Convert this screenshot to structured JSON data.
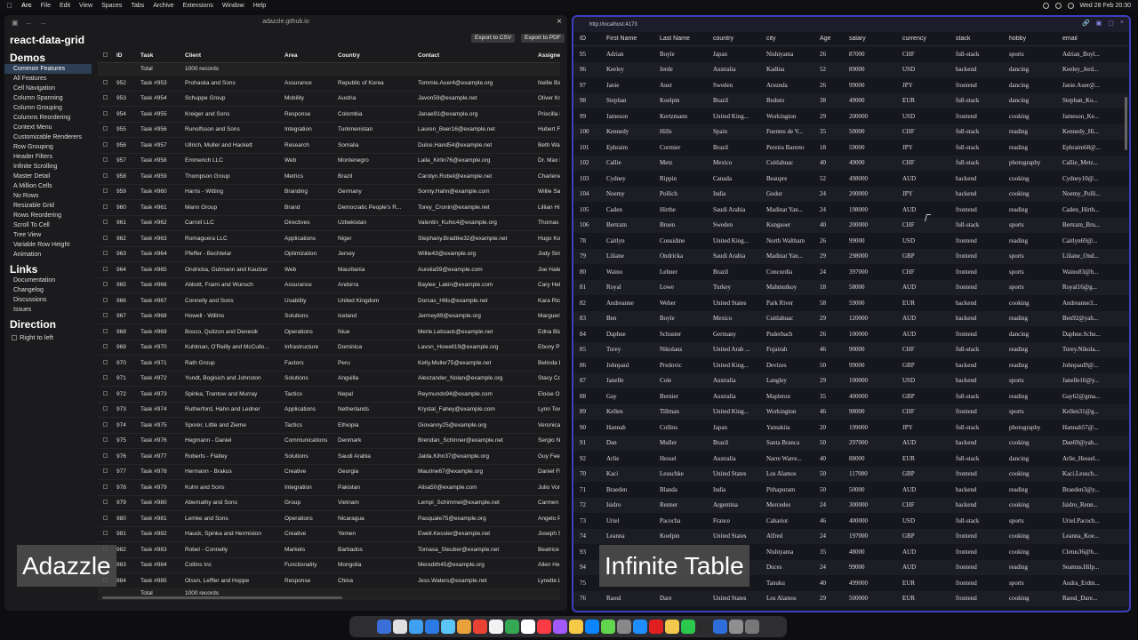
{
  "menubar": {
    "items": [
      "Arc",
      "File",
      "Edit",
      "View",
      "Spaces",
      "Tabs",
      "Archive",
      "Extensions",
      "Window",
      "Help"
    ],
    "clock": "Wed 28 Feb  20:30"
  },
  "left_window": {
    "url": "adazzle.github.io",
    "title": "react-data-grid",
    "sections": {
      "demos": "Demos",
      "links": "Links",
      "direction": "Direction"
    },
    "demos": [
      "Common Features",
      "All Features",
      "Cell Navigation",
      "Column Spanning",
      "Column Grouping",
      "Columns Reordering",
      "Context Menu",
      "Customizable Renderers",
      "Row Grouping",
      "Header Filters",
      "Infinite Scrolling",
      "Master Detail",
      "A Million Cells",
      "No Rows",
      "Resizable Grid",
      "Rows Reordering",
      "Scroll To Cell",
      "Tree View",
      "Variable Row Height",
      "Animation"
    ],
    "links": [
      "Documentation",
      "Changelog",
      "Discussions",
      "Issues"
    ],
    "rtl_label": "Right to left",
    "export_csv": "Export to CSV",
    "export_pdf": "Export to PDF",
    "columns": [
      "ID",
      "Task",
      "Client",
      "Area",
      "Country",
      "Contact",
      "Assignee"
    ],
    "total_label": "Total",
    "total_value": "1000 records",
    "rows": [
      [
        "952",
        "Task #953",
        "Prohaska and Sons",
        "Assurance",
        "Republic of Korea",
        "Tommie.Auer4@example.org",
        "Nellie Bay"
      ],
      [
        "953",
        "Task #954",
        "Schuppe Group",
        "Mobility",
        "Austria",
        "Javon59@example.net",
        "Oliver Kre"
      ],
      [
        "954",
        "Task #955",
        "Kreiger and Sons",
        "Response",
        "Colombia",
        "Janae91@example.org",
        "Priscilla L"
      ],
      [
        "955",
        "Task #956",
        "Runolfsson and Sons",
        "Integration",
        "Turkmenistan",
        "Lauren_Beer16@example.net",
        "Hubert Fe"
      ],
      [
        "956",
        "Task #957",
        "Ullrich, Muller and Hackett",
        "Research",
        "Somalia",
        "Dulce.Hand54@example.net",
        "Beth Walk"
      ],
      [
        "957",
        "Task #958",
        "Emmerich LLC",
        "Web",
        "Montenegro",
        "Laila_Kirlin76@example.org",
        "Dr. Max K"
      ],
      [
        "958",
        "Task #959",
        "Thompson Group",
        "Metrics",
        "Brazil",
        "Carolyn.Robel@example.net",
        "Charlene"
      ],
      [
        "959",
        "Task #960",
        "Harris - Witting",
        "Branding",
        "Germany",
        "Sonny.Hahn@example.com",
        "Willie Saw"
      ],
      [
        "960",
        "Task #961",
        "Mann Group",
        "Brand",
        "Democratic People's R...",
        "Torey_Cronin@example.net",
        "Lillian Hill"
      ],
      [
        "961",
        "Task #962",
        "Carroll LLC",
        "Directives",
        "Uzbekistan",
        "Valentin_Kuhic4@example.org",
        "Thomas E"
      ],
      [
        "962",
        "Task #963",
        "Romaguera LLC",
        "Applications",
        "Niger",
        "Stephany.Bradtke32@example.net",
        "Hugo Koc"
      ],
      [
        "963",
        "Task #964",
        "Pfeffer - Bechtelar",
        "Optimization",
        "Jersey",
        "Willie43@example.org",
        "Jody Sim"
      ],
      [
        "964",
        "Task #965",
        "Ondricka, Gutmann and Kautzer",
        "Web",
        "Mauritania",
        "Aurelia59@example.com",
        "Joe Haley"
      ],
      [
        "965",
        "Task #966",
        "Abbott, Frami and Wunsch",
        "Assurance",
        "Andorra",
        "Baylee_Lakin@example.com",
        "Cary Hett"
      ],
      [
        "966",
        "Task #967",
        "Connelly and Sons",
        "Usability",
        "United Kingdom",
        "Dorcas_Hills@example.net",
        "Kara Rtcl"
      ],
      [
        "967",
        "Task #968",
        "Howell - Willms",
        "Solutions",
        "Iceland",
        "Jermey89@example.org",
        "Marguerit"
      ],
      [
        "968",
        "Task #969",
        "Bosco, Quitzon and Denesik",
        "Operations",
        "Niue",
        "Merle.Lebsack@example.net",
        "Edna Blar"
      ],
      [
        "969",
        "Task #970",
        "Kuhlman, O'Reilly and McCullo...",
        "Infrastructure",
        "Dominica",
        "Lavon_Howell19@example.org",
        "Ebony Pre"
      ],
      [
        "970",
        "Task #971",
        "Rath Group",
        "Factors",
        "Peru",
        "Kelly.Muller75@example.net",
        "Belinda L"
      ],
      [
        "971",
        "Task #972",
        "Yundt, Bogisich and Johnston",
        "Solutions",
        "Anguilla",
        "Alexzander_Nolan@example.org",
        "Stacy Cor"
      ],
      [
        "972",
        "Task #973",
        "Spinka, Trantow and Murray",
        "Tactics",
        "Nepal",
        "Reymundo94@example.com",
        "Eloise Ort"
      ],
      [
        "973",
        "Task #974",
        "Rutherford, Hahn and Ledner",
        "Applications",
        "Netherlands",
        "Krystal_Fahey@example.com",
        "Lynn Tow"
      ],
      [
        "974",
        "Task #975",
        "Sporer, Little and Zieme",
        "Tactics",
        "Ethiopia",
        "Giovanny25@example.org",
        "Veronica I"
      ],
      [
        "975",
        "Task #976",
        "Hegmann - Daniel",
        "Communications",
        "Denmark",
        "Brendan_Schinner@example.net",
        "Sergio Nc"
      ],
      [
        "976",
        "Task #977",
        "Roberts - Flatley",
        "Solutions",
        "Saudi Arabia",
        "Jaida.Kihn37@example.org",
        "Guy Fees"
      ],
      [
        "977",
        "Task #978",
        "Hermann - Brakus",
        "Creative",
        "Georgia",
        "Maurine67@example.org",
        "Daniel Fla"
      ],
      [
        "978",
        "Task #979",
        "Kuhn and Sons",
        "Integration",
        "Pakistan",
        "Alisa50@example.com",
        "Julio Vonl"
      ],
      [
        "979",
        "Task #980",
        "Abernathy and Sons",
        "Group",
        "Vietnam",
        "Lempi_Schimmel@example.net",
        "Carmen H"
      ],
      [
        "980",
        "Task #981",
        "Lemke and Sons",
        "Operations",
        "Nicaragua",
        "Pasquale75@example.org",
        "Angelo Pf"
      ],
      [
        "981",
        "Task #982",
        "Hauck, Spinka and Hermiston",
        "Creative",
        "Yemen",
        "Ewell.Kessler@example.net",
        "Joseph Sl"
      ],
      [
        "982",
        "Task #983",
        "Robel - Connelly",
        "Markets",
        "Barbados",
        "Tomasa_Steuber@example.net",
        "Beatrice F"
      ],
      [
        "983",
        "Task #984",
        "Collins Inc",
        "Functionality",
        "Mongolia",
        "Meredith45@example.org",
        "Allen Herr"
      ],
      [
        "984",
        "Task #985",
        "Olson, Leffler and Hoppe",
        "Response",
        "China",
        "Jess.Waters@example.net",
        "Lynette Le"
      ]
    ]
  },
  "right_window": {
    "url": "http://localhost:4173",
    "columns": [
      "ID",
      "First Name",
      "Last Name",
      "country",
      "city",
      "Age",
      "salary",
      "currency",
      "stack",
      "hobby",
      "email"
    ],
    "rows": [
      [
        "95",
        "Adrian",
        "Boyle",
        "Japan",
        "Nishiyama",
        "26",
        "87000",
        "CHF",
        "full-stack",
        "sports",
        "Adrian_Boyl..."
      ],
      [
        "96",
        "Keeley",
        "Jerde",
        "Australia",
        "Kadina",
        "52",
        "89000",
        "USD",
        "backend",
        "dancing",
        "Keeley_Jerd..."
      ],
      [
        "97",
        "Janie",
        "Auer",
        "Sweden",
        "Arsunda",
        "26",
        "99000",
        "JPY",
        "frontend",
        "dancing",
        "Janie.Auer@..."
      ],
      [
        "98",
        "Stephan",
        "Koelpin",
        "Brazil",
        "Reduto",
        "38",
        "49000",
        "EUR",
        "full-stack",
        "dancing",
        "Stephan_Ko..."
      ],
      [
        "99",
        "Jameson",
        "Kertzmann",
        "United King...",
        "Workington",
        "29",
        "200000",
        "USD",
        "frontend",
        "cooking",
        "Jameson_Ke..."
      ],
      [
        "100",
        "Kennedy",
        "Hills",
        "Spain",
        "Fuentes de V...",
        "35",
        "50000",
        "CHF",
        "full-stack",
        "reading",
        "Kennedy_Hi..."
      ],
      [
        "101",
        "Ephraim",
        "Cormier",
        "Brazil",
        "Pereira Barreto",
        "18",
        "59000",
        "JPY",
        "full-stack",
        "reading",
        "Ephraim68@..."
      ],
      [
        "102",
        "Callie",
        "Metz",
        "Mexico",
        "Cuitlahuac",
        "40",
        "49000",
        "CHF",
        "full-stack",
        "photography",
        "Callie_Metz..."
      ],
      [
        "103",
        "Cydney",
        "Rippin",
        "Canada",
        "Beaupre",
        "52",
        "498000",
        "AUD",
        "backend",
        "cooking",
        "Cydney10@..."
      ],
      [
        "104",
        "Noemy",
        "Pollich",
        "India",
        "Gudur",
        "24",
        "200000",
        "JPY",
        "backend",
        "cooking",
        "Noemy_Polli..."
      ],
      [
        "105",
        "Caden",
        "Hirthe",
        "Saudi Arabia",
        "Madinat Yan...",
        "24",
        "198000",
        "AUD",
        "frontend",
        "reading",
        "Caden_Hirth..."
      ],
      [
        "106",
        "Bertram",
        "Bruen",
        "Sweden",
        "Kungsoer",
        "40",
        "200000",
        "CHF",
        "full-stack",
        "sports",
        "Bertram_Bru..."
      ],
      [
        "78",
        "Caitlyn",
        "Considine",
        "United King...",
        "North Waltham",
        "26",
        "99000",
        "USD",
        "frontend",
        "reading",
        "Caitlyn69@..."
      ],
      [
        "79",
        "Liliane",
        "Ondricka",
        "Saudi Arabia",
        "Madinat Yan...",
        "29",
        "298000",
        "GBP",
        "frontend",
        "sports",
        "Liliane_Ond..."
      ],
      [
        "80",
        "Waino",
        "Lehner",
        "Brazil",
        "Concordia",
        "24",
        "397000",
        "CHF",
        "frontend",
        "sports",
        "Waino83@h..."
      ],
      [
        "81",
        "Royal",
        "Lowe",
        "Turkey",
        "Mahmutkoy",
        "18",
        "58000",
        "AUD",
        "frontend",
        "sports",
        "Royal16@g..."
      ],
      [
        "82",
        "Andreanne",
        "Weber",
        "United States",
        "Park River",
        "58",
        "59000",
        "EUR",
        "backend",
        "cooking",
        "Andreanne3..."
      ],
      [
        "83",
        "Ben",
        "Boyle",
        "Mexico",
        "Cuitlahuac",
        "29",
        "120000",
        "AUD",
        "backend",
        "reading",
        "Ben92@yah..."
      ],
      [
        "84",
        "Daphne",
        "Schuster",
        "Germany",
        "Puderbach",
        "26",
        "100000",
        "AUD",
        "frontend",
        "dancing",
        "Daphne.Schu..."
      ],
      [
        "85",
        "Torey",
        "Nikolaus",
        "United Arab ...",
        "Fujairah",
        "46",
        "90000",
        "CHF",
        "full-stack",
        "reading",
        "Torey.Nikola..."
      ],
      [
        "86",
        "Johnpaul",
        "Predovic",
        "United King...",
        "Devizes",
        "50",
        "99000",
        "GBP",
        "backend",
        "reading",
        "Johnpaul9@..."
      ],
      [
        "87",
        "Janelle",
        "Cole",
        "Australia",
        "Langley",
        "29",
        "100000",
        "USD",
        "backend",
        "sports",
        "Janelle16@y..."
      ],
      [
        "88",
        "Gay",
        "Bernier",
        "Australia",
        "Mapleton",
        "35",
        "400000",
        "GBP",
        "full-stack",
        "reading",
        "Gay62@gma..."
      ],
      [
        "89",
        "Kellen",
        "Tillman",
        "United King...",
        "Workington",
        "46",
        "98000",
        "CHF",
        "frontend",
        "sports",
        "Kellen31@g..."
      ],
      [
        "90",
        "Hannah",
        "Collins",
        "Japan",
        "Yamakita",
        "20",
        "199000",
        "JPY",
        "full-stack",
        "photography",
        "Hannah57@..."
      ],
      [
        "91",
        "Dan",
        "Muller",
        "Brazil",
        "Santa Branca",
        "50",
        "297000",
        "AUD",
        "backend",
        "cooking",
        "Dan69@yah..."
      ],
      [
        "92",
        "Arlie",
        "Hessel",
        "Australia",
        "Narre Warre...",
        "40",
        "88000",
        "EUR",
        "full-stack",
        "dancing",
        "Arlie_Hessel..."
      ],
      [
        "70",
        "Kaci",
        "Leuschke",
        "United States",
        "Los Alamos",
        "50",
        "117000",
        "GBP",
        "frontend",
        "cooking",
        "Kaci.Leusch..."
      ],
      [
        "71",
        "Braeden",
        "Blanda",
        "India",
        "Pithapuram",
        "50",
        "50000",
        "AUD",
        "backend",
        "reading",
        "Braeden3@y..."
      ],
      [
        "72",
        "Isidro",
        "Renner",
        "Argentina",
        "Mercedes",
        "24",
        "300000",
        "CHF",
        "backend",
        "cooking",
        "Isidro_Renn..."
      ],
      [
        "73",
        "Uriel",
        "Pacocha",
        "France",
        "Cabariot",
        "46",
        "400000",
        "USD",
        "full-stack",
        "sports",
        "Uriel.Pacoch..."
      ],
      [
        "74",
        "Leanna",
        "Koelpin",
        "United States",
        "Alfred",
        "24",
        "197000",
        "GBP",
        "frontend",
        "cooking",
        "Leanna_Koe..."
      ],
      [
        "93",
        "",
        "",
        "",
        "Nishiyama",
        "35",
        "48000",
        "AUD",
        "frontend",
        "cooking",
        "Cletus36@h..."
      ],
      [
        "94",
        "",
        "",
        "",
        "Duces",
        "24",
        "99000",
        "AUD",
        "frontend",
        "reading",
        "Seamus.Hilp..."
      ],
      [
        "75",
        "",
        "",
        "",
        "Tanuku",
        "40",
        "499000",
        "EUR",
        "frontend",
        "sports",
        "Audra_Erdm..."
      ],
      [
        "76",
        "Raoul",
        "Dare",
        "United States",
        "Los Alamos",
        "29",
        "500000",
        "EUR",
        "frontend",
        "cooking",
        "Raoul_Dare..."
      ]
    ]
  },
  "captions": {
    "left": "Adazzle",
    "right": "Infinite Table"
  },
  "dock_colors": [
    "#3a6fd8",
    "#e0e0e0",
    "#3fa0f0",
    "#2c7be5",
    "#5bc6f5",
    "#e9a23b",
    "#ea4335",
    "#f2f2f2",
    "#34a853",
    "#ffffff",
    "#fc3c44",
    "#a259ff",
    "#f7c948",
    "#0a84ff",
    "#62d54f",
    "#888888",
    "#1f8fff",
    "#e02020",
    "#f2c94c",
    "#2cc84d",
    "#2b2b2b",
    "#2f6ddb",
    "#8f8f8f",
    "#777777"
  ]
}
